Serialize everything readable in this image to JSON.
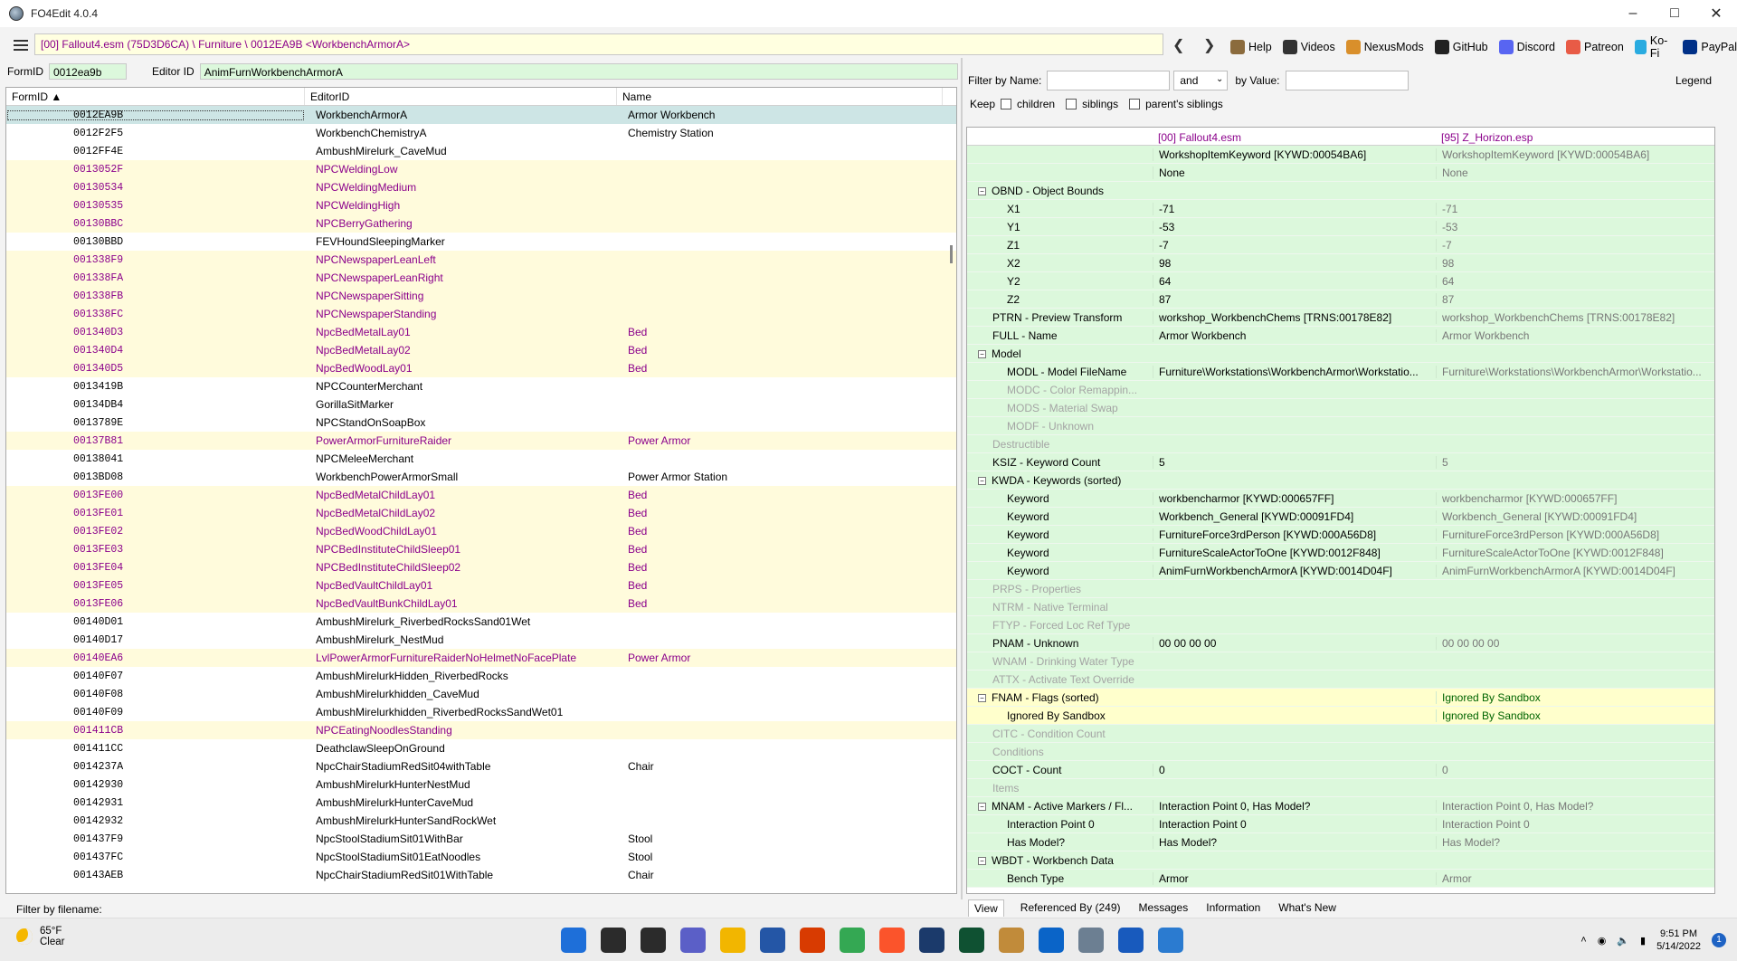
{
  "window": {
    "title": "FO4Edit 4.0.4"
  },
  "toolbar": {
    "path": "[00] Fallout4.esm (75D3D6CA) \\ Furniture \\ 0012EA9B <WorkbenchArmorA>",
    "links": [
      {
        "name": "help-link",
        "label": "Help",
        "color": "#8b6b3d"
      },
      {
        "name": "videos-link",
        "label": "Videos",
        "color": "#333333"
      },
      {
        "name": "nexusmods-link",
        "label": "NexusMods",
        "color": "#d98f2b"
      },
      {
        "name": "github-link",
        "label": "GitHub",
        "color": "#222222"
      },
      {
        "name": "discord-link",
        "label": "Discord",
        "color": "#5865f2"
      },
      {
        "name": "patreon-link",
        "label": "Patreon",
        "color": "#e85b46"
      },
      {
        "name": "kofi-link",
        "label": "Ko-Fi",
        "color": "#29abe0"
      },
      {
        "name": "paypal-link",
        "label": "PayPal",
        "color": "#003087"
      }
    ]
  },
  "record": {
    "formid_label": "FormID",
    "formid": "0012ea9b",
    "editorid_label": "Editor ID",
    "editorid": "AnimFurnWorkbenchArmorA"
  },
  "leftlist": {
    "headers": [
      "FormID",
      "EditorID",
      "Name"
    ],
    "rows": [
      {
        "id": "0012EA9B",
        "eid": "WorkbenchArmorA",
        "name": "Armor Workbench",
        "style": "sel"
      },
      {
        "id": "0012F2F5",
        "eid": "WorkbenchChemistryA",
        "name": "Chemistry Station",
        "style": ""
      },
      {
        "id": "0012FF4E",
        "eid": "AmbushMirelurk_CaveMud",
        "name": "",
        "style": ""
      },
      {
        "id": "0013052F",
        "eid": "NPCWeldingLow",
        "name": "",
        "style": "y"
      },
      {
        "id": "00130534",
        "eid": "NPCWeldingMedium",
        "name": "",
        "style": "y"
      },
      {
        "id": "00130535",
        "eid": "NPCWeldingHigh",
        "name": "",
        "style": "y"
      },
      {
        "id": "00130BBC",
        "eid": "NPCBerryGathering",
        "name": "",
        "style": "y"
      },
      {
        "id": "00130BBD",
        "eid": "FEVHoundSleepingMarker",
        "name": "",
        "style": ""
      },
      {
        "id": "001338F9",
        "eid": "NPCNewspaperLeanLeft",
        "name": "",
        "style": "y"
      },
      {
        "id": "001338FA",
        "eid": "NPCNewspaperLeanRight",
        "name": "",
        "style": "y"
      },
      {
        "id": "001338FB",
        "eid": "NPCNewspaperSitting",
        "name": "",
        "style": "y"
      },
      {
        "id": "001338FC",
        "eid": "NPCNewspaperStanding",
        "name": "",
        "style": "y"
      },
      {
        "id": "001340D3",
        "eid": "NpcBedMetalLay01",
        "name": "Bed",
        "style": "y"
      },
      {
        "id": "001340D4",
        "eid": "NpcBedMetalLay02",
        "name": "Bed",
        "style": "y"
      },
      {
        "id": "001340D5",
        "eid": "NpcBedWoodLay01",
        "name": "Bed",
        "style": "y"
      },
      {
        "id": "0013419B",
        "eid": "NPCCounterMerchant",
        "name": "",
        "style": ""
      },
      {
        "id": "00134DB4",
        "eid": "GorillaSitMarker",
        "name": "",
        "style": ""
      },
      {
        "id": "0013789E",
        "eid": "NPCStandOnSoapBox",
        "name": "",
        "style": ""
      },
      {
        "id": "00137B81",
        "eid": "PowerArmorFurnitureRaider",
        "name": "Power Armor",
        "style": "y"
      },
      {
        "id": "00138041",
        "eid": "NPCMeleeMerchant",
        "name": "",
        "style": ""
      },
      {
        "id": "0013BD08",
        "eid": "WorkbenchPowerArmorSmall",
        "name": "Power Armor Station",
        "style": ""
      },
      {
        "id": "0013FE00",
        "eid": "NpcBedMetalChildLay01",
        "name": "Bed",
        "style": "y"
      },
      {
        "id": "0013FE01",
        "eid": "NpcBedMetalChildLay02",
        "name": "Bed",
        "style": "y"
      },
      {
        "id": "0013FE02",
        "eid": "NpcBedWoodChildLay01",
        "name": "Bed",
        "style": "y"
      },
      {
        "id": "0013FE03",
        "eid": "NPCBedInstituteChildSleep01",
        "name": "Bed",
        "style": "y"
      },
      {
        "id": "0013FE04",
        "eid": "NPCBedInstituteChildSleep02",
        "name": "Bed",
        "style": "y"
      },
      {
        "id": "0013FE05",
        "eid": "NpcBedVaultChildLay01",
        "name": "Bed",
        "style": "y"
      },
      {
        "id": "0013FE06",
        "eid": "NpcBedVaultBunkChildLay01",
        "name": "Bed",
        "style": "y"
      },
      {
        "id": "00140D01",
        "eid": "AmbushMirelurk_RiverbedRocksSand01Wet",
        "name": "",
        "style": ""
      },
      {
        "id": "00140D17",
        "eid": "AmbushMirelurk_NestMud",
        "name": "",
        "style": ""
      },
      {
        "id": "00140EA6",
        "eid": "LvlPowerArmorFurnitureRaiderNoHelmetNoFacePlate",
        "name": "Power Armor",
        "style": "y"
      },
      {
        "id": "00140F07",
        "eid": "AmbushMirelurkHidden_RiverbedRocks",
        "name": "",
        "style": ""
      },
      {
        "id": "00140F08",
        "eid": "AmbushMirelurkhidden_CaveMud",
        "name": "",
        "style": ""
      },
      {
        "id": "00140F09",
        "eid": "AmbushMirelurkhidden_RiverbedRocksSandWet01",
        "name": "",
        "style": ""
      },
      {
        "id": "001411CB",
        "eid": "NPCEatingNoodlesStanding",
        "name": "",
        "style": "y"
      },
      {
        "id": "001411CC",
        "eid": "DeathclawSleepOnGround",
        "name": "",
        "style": ""
      },
      {
        "id": "0014237A",
        "eid": "NpcChairStadiumRedSit04withTable",
        "name": "Chair",
        "style": ""
      },
      {
        "id": "00142930",
        "eid": "AmbushMirelurkHunterNestMud",
        "name": "",
        "style": ""
      },
      {
        "id": "00142931",
        "eid": "AmbushMirelurkHunterCaveMud",
        "name": "",
        "style": ""
      },
      {
        "id": "00142932",
        "eid": "AmbushMirelurkHunterSandRockWet",
        "name": "",
        "style": ""
      },
      {
        "id": "001437F9",
        "eid": "NpcStoolStadiumSit01WithBar",
        "name": "Stool",
        "style": ""
      },
      {
        "id": "001437FC",
        "eid": "NpcStoolStadiumSit01EatNoodles",
        "name": "Stool",
        "style": ""
      },
      {
        "id": "00143AEB",
        "eid": "NpcChairStadiumRedSit01WithTable",
        "name": "Chair",
        "style": ""
      }
    ],
    "filter_label": "Filter by filename:"
  },
  "rightfilter": {
    "name_label": "Filter by Name:",
    "and_label": "and",
    "value_label": "by Value:",
    "keep_label": "Keep",
    "children": "children",
    "siblings": "siblings",
    "parents": "parent's siblings",
    "legend": "Legend"
  },
  "detail": {
    "col1": "[00] Fallout4.esm",
    "col2": "[95] Z_Horizon.esp",
    "rows": [
      {
        "l": "",
        "v1": "WorkshopItemKeyword [KYWD:00054BA6]",
        "v2": "WorkshopItemKeyword [KYWD:00054BA6]",
        "ind": 2,
        "exp": "",
        "dim": false,
        "yel": false
      },
      {
        "l": "",
        "v1": "None",
        "v2": "None",
        "ind": 2,
        "exp": "",
        "dim": false,
        "yel": false
      },
      {
        "l": "OBND - Object Bounds",
        "v1": "",
        "v2": "",
        "ind": 0,
        "exp": "−",
        "dim": false,
        "yel": false
      },
      {
        "l": "X1",
        "v1": "-71",
        "v2": "-71",
        "ind": 2,
        "exp": "",
        "dim": false,
        "yel": false
      },
      {
        "l": "Y1",
        "v1": "-53",
        "v2": "-53",
        "ind": 2,
        "exp": "",
        "dim": false,
        "yel": false
      },
      {
        "l": "Z1",
        "v1": "-7",
        "v2": "-7",
        "ind": 2,
        "exp": "",
        "dim": false,
        "yel": false
      },
      {
        "l": "X2",
        "v1": "98",
        "v2": "98",
        "ind": 2,
        "exp": "",
        "dim": false,
        "yel": false
      },
      {
        "l": "Y2",
        "v1": "64",
        "v2": "64",
        "ind": 2,
        "exp": "",
        "dim": false,
        "yel": false
      },
      {
        "l": "Z2",
        "v1": "87",
        "v2": "87",
        "ind": 2,
        "exp": "",
        "dim": false,
        "yel": false
      },
      {
        "l": "PTRN - Preview Transform",
        "v1": "workshop_WorkbenchChems [TRNS:00178E82]",
        "v2": "workshop_WorkbenchChems [TRNS:00178E82]",
        "ind": 1,
        "exp": "",
        "dim": false,
        "yel": false
      },
      {
        "l": "FULL - Name",
        "v1": "Armor Workbench",
        "v2": "Armor Workbench",
        "ind": 1,
        "exp": "",
        "dim": false,
        "yel": false
      },
      {
        "l": "Model",
        "v1": "",
        "v2": "",
        "ind": 0,
        "exp": "−",
        "dim": false,
        "yel": false
      },
      {
        "l": "MODL - Model FileName",
        "v1": "Furniture\\Workstations\\WorkbenchArmor\\Workstatio...",
        "v2": "Furniture\\Workstations\\WorkbenchArmor\\Workstatio...",
        "ind": 2,
        "exp": "",
        "dim": false,
        "yel": false
      },
      {
        "l": "MODC - Color Remappin...",
        "v1": "",
        "v2": "",
        "ind": 2,
        "exp": "",
        "dim": true,
        "yel": false
      },
      {
        "l": "MODS - Material Swap",
        "v1": "",
        "v2": "",
        "ind": 2,
        "exp": "",
        "dim": true,
        "yel": false
      },
      {
        "l": "MODF - Unknown",
        "v1": "",
        "v2": "",
        "ind": 2,
        "exp": "",
        "dim": true,
        "yel": false
      },
      {
        "l": "Destructible",
        "v1": "",
        "v2": "",
        "ind": 1,
        "exp": "",
        "dim": true,
        "yel": false
      },
      {
        "l": "KSIZ - Keyword Count",
        "v1": "5",
        "v2": "5",
        "ind": 1,
        "exp": "",
        "dim": false,
        "yel": false
      },
      {
        "l": "KWDA - Keywords (sorted)",
        "v1": "",
        "v2": "",
        "ind": 0,
        "exp": "−",
        "dim": false,
        "yel": false
      },
      {
        "l": "Keyword",
        "v1": "workbencharmor [KYWD:000657FF]",
        "v2": "workbencharmor [KYWD:000657FF]",
        "ind": 2,
        "exp": "",
        "dim": false,
        "yel": false
      },
      {
        "l": "Keyword",
        "v1": "Workbench_General [KYWD:00091FD4]",
        "v2": "Workbench_General [KYWD:00091FD4]",
        "ind": 2,
        "exp": "",
        "dim": false,
        "yel": false
      },
      {
        "l": "Keyword",
        "v1": "FurnitureForce3rdPerson [KYWD:000A56D8]",
        "v2": "FurnitureForce3rdPerson [KYWD:000A56D8]",
        "ind": 2,
        "exp": "",
        "dim": false,
        "yel": false
      },
      {
        "l": "Keyword",
        "v1": "FurnitureScaleActorToOne [KYWD:0012F848]",
        "v2": "FurnitureScaleActorToOne [KYWD:0012F848]",
        "ind": 2,
        "exp": "",
        "dim": false,
        "yel": false
      },
      {
        "l": "Keyword",
        "v1": "AnimFurnWorkbenchArmorA [KYWD:0014D04F]",
        "v2": "AnimFurnWorkbenchArmorA [KYWD:0014D04F]",
        "ind": 2,
        "exp": "",
        "dim": false,
        "yel": false
      },
      {
        "l": "PRPS - Properties",
        "v1": "",
        "v2": "",
        "ind": 1,
        "exp": "",
        "dim": true,
        "yel": false
      },
      {
        "l": "NTRM - Native Terminal",
        "v1": "",
        "v2": "",
        "ind": 1,
        "exp": "",
        "dim": true,
        "yel": false
      },
      {
        "l": "FTYP - Forced Loc Ref Type",
        "v1": "",
        "v2": "",
        "ind": 1,
        "exp": "",
        "dim": true,
        "yel": false
      },
      {
        "l": "PNAM - Unknown",
        "v1": "00 00 00 00",
        "v2": "00 00 00 00",
        "ind": 1,
        "exp": "",
        "dim": false,
        "yel": false
      },
      {
        "l": "WNAM - Drinking Water Type",
        "v1": "",
        "v2": "",
        "ind": 1,
        "exp": "",
        "dim": true,
        "yel": false
      },
      {
        "l": "ATTX - Activate Text Override",
        "v1": "",
        "v2": "",
        "ind": 1,
        "exp": "",
        "dim": true,
        "yel": false
      },
      {
        "l": "FNAM - Flags (sorted)",
        "v1": "",
        "v2": "Ignored By Sandbox",
        "ind": 0,
        "exp": "−",
        "dim": false,
        "yel": true
      },
      {
        "l": "Ignored By Sandbox",
        "v1": "",
        "v2": "Ignored By Sandbox",
        "ind": 2,
        "exp": "",
        "dim": false,
        "yel": true
      },
      {
        "l": "CITC - Condition Count",
        "v1": "",
        "v2": "",
        "ind": 1,
        "exp": "",
        "dim": true,
        "yel": false
      },
      {
        "l": "Conditions",
        "v1": "",
        "v2": "",
        "ind": 1,
        "exp": "",
        "dim": true,
        "yel": false
      },
      {
        "l": "COCT - Count",
        "v1": "0",
        "v2": "0",
        "ind": 1,
        "exp": "",
        "dim": false,
        "yel": false
      },
      {
        "l": "Items",
        "v1": "",
        "v2": "",
        "ind": 1,
        "exp": "",
        "dim": true,
        "yel": false
      },
      {
        "l": "MNAM - Active Markers / Fl...",
        "v1": "Interaction Point 0, Has Model?",
        "v2": "Interaction Point 0, Has Model?",
        "ind": 0,
        "exp": "−",
        "dim": false,
        "yel": false
      },
      {
        "l": "Interaction Point 0",
        "v1": "Interaction Point 0",
        "v2": "Interaction Point 0",
        "ind": 2,
        "exp": "",
        "dim": false,
        "yel": false
      },
      {
        "l": "Has Model?",
        "v1": "Has Model?",
        "v2": "Has Model?",
        "ind": 2,
        "exp": "",
        "dim": false,
        "yel": false
      },
      {
        "l": "WBDT - Workbench Data",
        "v1": "",
        "v2": "",
        "ind": 0,
        "exp": "−",
        "dim": false,
        "yel": false
      },
      {
        "l": "Bench Type",
        "v1": "Armor",
        "v2": "Armor",
        "ind": 2,
        "exp": "",
        "dim": false,
        "yel": false
      }
    ],
    "tabs": [
      "View",
      "Referenced By (249)",
      "Messages",
      "Information",
      "What's New"
    ]
  },
  "taskbar": {
    "temp": "65°F",
    "cond": "Clear",
    "time": "9:51 PM",
    "date": "5/14/2022",
    "notif": "1",
    "apps": [
      {
        "name": "start-icon",
        "color": "#1e6fd9"
      },
      {
        "name": "search-icon",
        "color": "#2b2b2b"
      },
      {
        "name": "task-view-icon",
        "color": "#2b2b2b"
      },
      {
        "name": "chat-icon",
        "color": "#5b5fc7"
      },
      {
        "name": "file-explorer-icon",
        "color": "#f2b600"
      },
      {
        "name": "vscode-icon",
        "color": "#2456a6"
      },
      {
        "name": "office-icon",
        "color": "#d83b01"
      },
      {
        "name": "chrome-icon",
        "color": "#34a853"
      },
      {
        "name": "brave-icon",
        "color": "#fb542b"
      },
      {
        "name": "steam-icon",
        "color": "#1b3a6b"
      },
      {
        "name": "game-icon",
        "color": "#0f5132"
      },
      {
        "name": "hammer-icon",
        "color": "#c18b3a"
      },
      {
        "name": "mail-icon",
        "color": "#0a64c8"
      },
      {
        "name": "fo4edit-icon",
        "color": "#6c7f92"
      },
      {
        "name": "word-icon",
        "color": "#185abd"
      },
      {
        "name": "photos-icon",
        "color": "#2b7bd0"
      }
    ]
  }
}
